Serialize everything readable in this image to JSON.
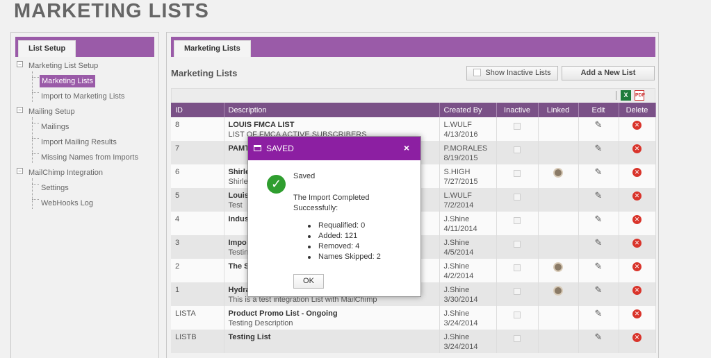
{
  "page": {
    "title": "MARKETING LISTS"
  },
  "left_panel": {
    "tab_label": "List Setup",
    "tree": [
      {
        "label": "Marketing List Setup",
        "level": 0
      },
      {
        "label": "Marketing Lists",
        "level": 1,
        "selected": true
      },
      {
        "label": "Import to Marketing Lists",
        "level": 1
      },
      {
        "label": "Mailing Setup",
        "level": 0
      },
      {
        "label": "Mailings",
        "level": 1
      },
      {
        "label": "Import Mailing Results",
        "level": 1
      },
      {
        "label": "Missing Names from Imports",
        "level": 1
      },
      {
        "label": "MailChimp Integration",
        "level": 0
      },
      {
        "label": "Settings",
        "level": 1
      },
      {
        "label": "WebHooks Log",
        "level": 1
      }
    ]
  },
  "main_panel": {
    "tab_label": "Marketing Lists",
    "section_title": "Marketing Lists",
    "show_inactive_label": "Show Inactive Lists",
    "add_button_label": "Add a New List",
    "export_excel_icon": "excel-icon",
    "export_pdf_icon": "pdf-icon",
    "columns": [
      "ID",
      "Description",
      "Created By",
      "Inactive",
      "Linked",
      "Edit",
      "Delete"
    ],
    "rows": [
      {
        "id": "8",
        "name": "LOUIS FMCA LIST",
        "desc": "LIST OF FMCA ACTIVE SUBSCRIBERS",
        "user": "L.WULF",
        "date": "4/13/2016",
        "linked": false
      },
      {
        "id": "7",
        "name": "PAMT",
        "desc": "",
        "user": "P.MORALES",
        "date": "8/19/2015",
        "linked": false
      },
      {
        "id": "6",
        "name": "Shirle",
        "desc": "Shirle",
        "user": "S.HIGH",
        "date": "7/27/2015",
        "linked": true
      },
      {
        "id": "5",
        "name": "Louis",
        "desc": "Test",
        "user": "L.WULF",
        "date": "7/2/2014",
        "linked": false
      },
      {
        "id": "4",
        "name": "Indus",
        "desc": "",
        "user": "J.Shine",
        "date": "4/11/2014",
        "linked": false
      },
      {
        "id": "3",
        "name": "Impo",
        "desc": "Testin",
        "user": "J.Shine",
        "date": "4/5/2014",
        "linked": false
      },
      {
        "id": "2",
        "name": "The S",
        "desc": "",
        "user": "J.Shine",
        "date": "4/2/2014",
        "linked": true
      },
      {
        "id": "1",
        "name": "Hydra",
        "desc": "This is a test integration List with MailChimp",
        "user": "J.Shine",
        "date": "3/30/2014",
        "linked": true
      },
      {
        "id": "LISTA",
        "name": "Product Promo List - Ongoing",
        "desc": "Testing Description",
        "user": "J.Shine",
        "date": "3/24/2014",
        "linked": false
      },
      {
        "id": "LISTB",
        "name": "Testing List",
        "desc": "",
        "user": "J.Shine",
        "date": "3/24/2014",
        "linked": false
      }
    ]
  },
  "dialog": {
    "title": "SAVED",
    "close_glyph": "×",
    "icon": "check-circle-icon",
    "saved_text": "Saved",
    "message": "The Import Completed Successfully:",
    "results": [
      "Requalified: 0",
      "Added: 121",
      "Removed: 4",
      "Names Skipped: 2"
    ],
    "ok_label": "OK"
  },
  "colors": {
    "accent": "#9a5ba8",
    "header_row": "#7a5187",
    "dialog_header": "#8c1fa2",
    "delete": "#d9342b",
    "success": "#2f9e2f"
  }
}
